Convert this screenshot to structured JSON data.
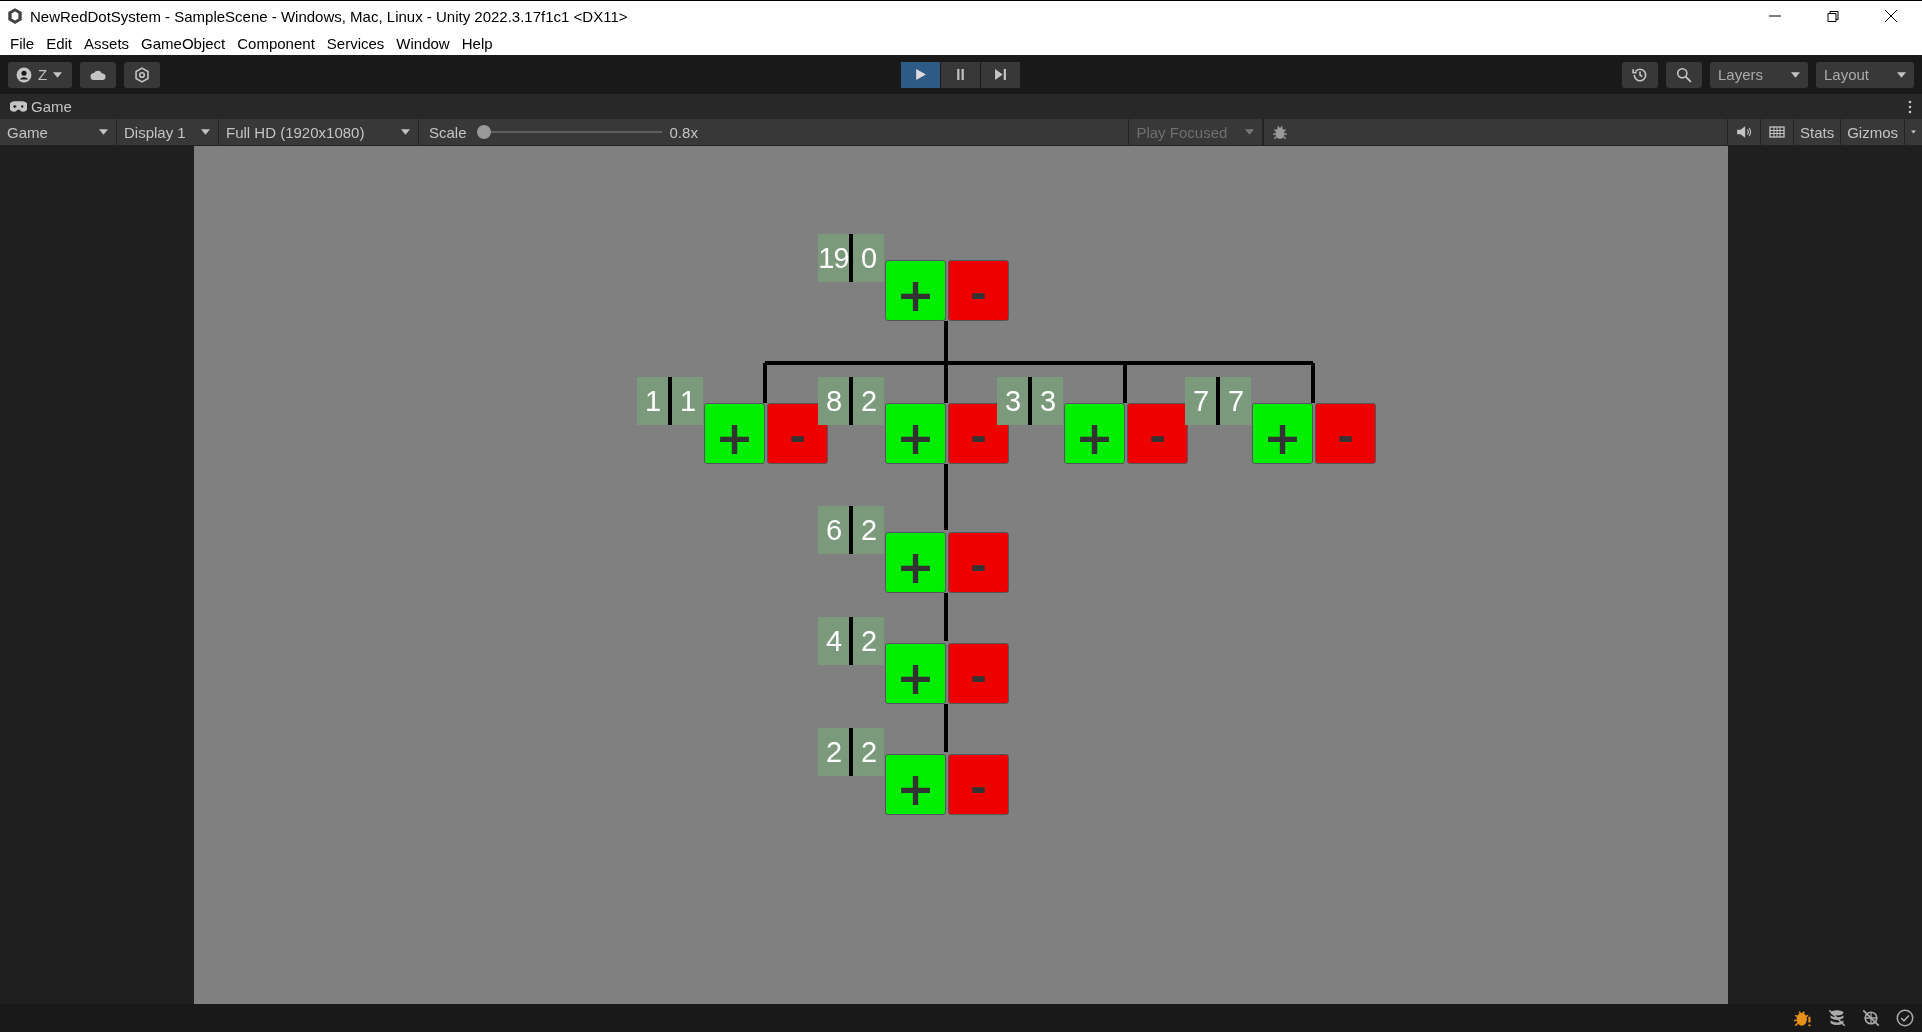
{
  "window": {
    "title": "NewRedDotSystem - SampleScene - Windows, Mac, Linux - Unity 2022.3.17f1c1 <DX11>"
  },
  "menu": [
    "File",
    "Edit",
    "Assets",
    "GameObject",
    "Component",
    "Services",
    "Window",
    "Help"
  ],
  "toolbar": {
    "account": "Z",
    "play": [
      {
        "kind": "play",
        "selected": true
      },
      {
        "kind": "pause",
        "selected": false
      },
      {
        "kind": "step",
        "selected": false
      }
    ],
    "layers": "Layers",
    "layout": "Layout"
  },
  "game_tab": {
    "label": "Game"
  },
  "game_toolbar": {
    "view": "Game",
    "display": "Display 1",
    "resolution": "Full HD (1920x1080)",
    "scale_label": "Scale",
    "scale": {
      "level": 0
    },
    "scale_value": "0.8x",
    "play_focused": {
      "label": "Play Focused",
      "disabled": true
    },
    "stats": "Stats",
    "gizmos": "Gizmos"
  },
  "tree": {
    "counts": [
      "19",
      "0"
    ],
    "add": "+",
    "remove": "-",
    "children": [
      {
        "counts": [
          "1",
          "1"
        ],
        "add": "+",
        "remove": "-"
      },
      {
        "counts": [
          "8",
          "2"
        ],
        "add": "+",
        "remove": "-",
        "children": [
          {
            "counts": [
              "6",
              "2"
            ],
            "add": "+",
            "remove": "-",
            "children": [
              {
                "counts": [
                  "4",
                  "2"
                ],
                "add": "+",
                "remove": "-",
                "children": [
                  {
                    "counts": [
                      "2",
                      "2"
                    ],
                    "add": "+",
                    "remove": "-"
                  }
                ]
              }
            ]
          }
        ]
      },
      {
        "counts": [
          "3",
          "3"
        ],
        "add": "+",
        "remove": "-"
      },
      {
        "counts": [
          "7",
          "7"
        ],
        "add": "+",
        "remove": "-"
      }
    ]
  }
}
